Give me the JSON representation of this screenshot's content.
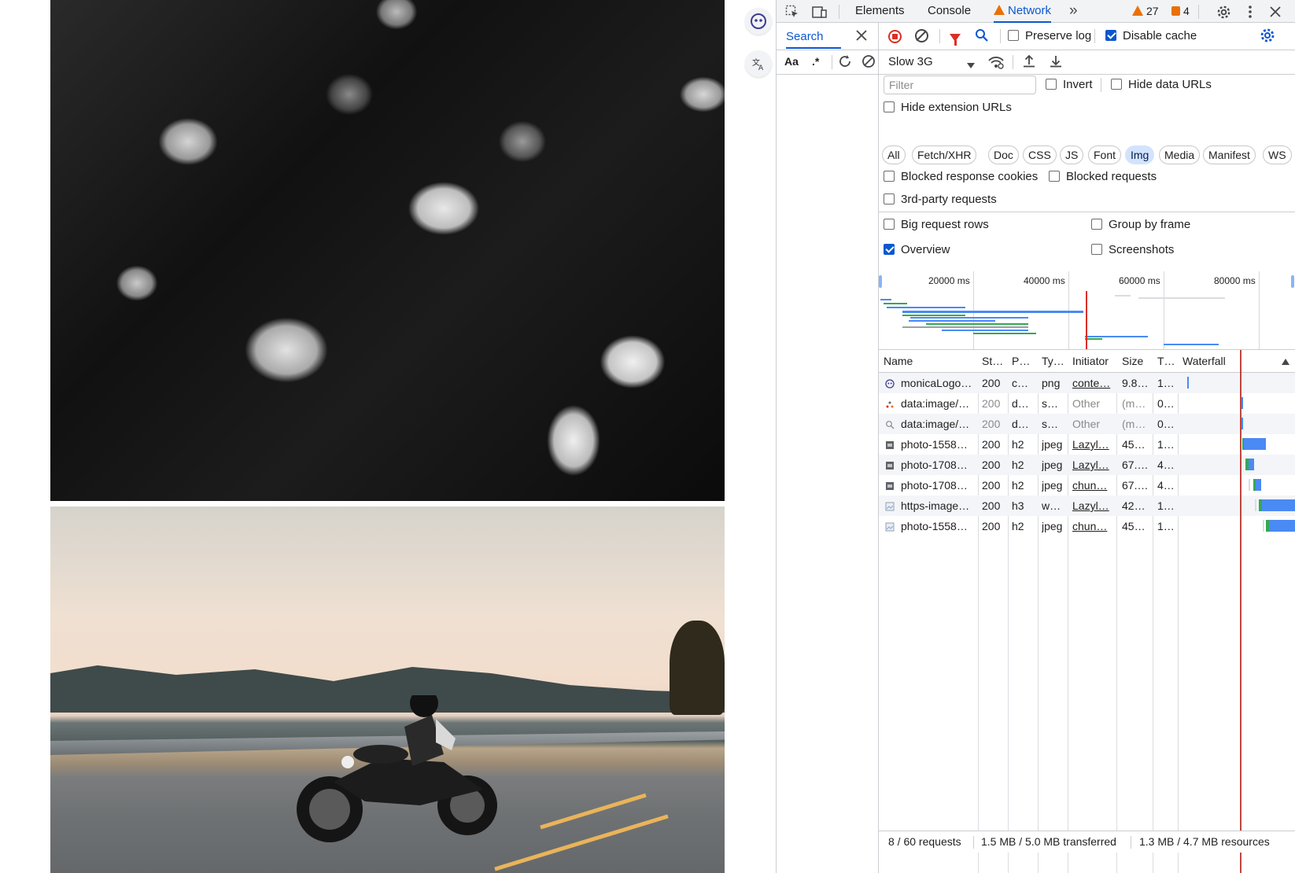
{
  "devtools": {
    "tabs": [
      {
        "label": "Elements",
        "active": false
      },
      {
        "label": "Console",
        "active": false
      },
      {
        "label": "Network",
        "active": true,
        "warning": true
      }
    ],
    "more_tabs_label": "»",
    "warnings_count": "27",
    "issues_count": "4"
  },
  "search_drawer": {
    "tab_label": "Search",
    "match_case_label": "Aa",
    "regex_label": ".*"
  },
  "network_toolbar": {
    "preserve_log_label": "Preserve log",
    "preserve_log_checked": false,
    "disable_cache_label": "Disable cache",
    "disable_cache_checked": true,
    "throttling_value": "Slow 3G"
  },
  "filters": {
    "filter_placeholder": "Filter",
    "invert_label": "Invert",
    "hide_data_urls_label": "Hide data URLs",
    "hide_extension_urls_label": "Hide extension URLs",
    "type_chips": [
      {
        "label": "All",
        "active": false
      },
      {
        "label": "Fetch/XHR",
        "active": false
      },
      {
        "label": "Doc",
        "active": false
      },
      {
        "label": "CSS",
        "active": false
      },
      {
        "label": "JS",
        "active": false
      },
      {
        "label": "Font",
        "active": false
      },
      {
        "label": "Img",
        "active": true
      },
      {
        "label": "Media",
        "active": false
      },
      {
        "label": "Manifest",
        "active": false
      },
      {
        "label": "WS",
        "active": false
      }
    ],
    "blocked_response_cookies_label": "Blocked response cookies",
    "blocked_requests_label": "Blocked requests",
    "third_party_label": "3rd-party requests"
  },
  "settings": {
    "big_request_rows_label": "Big request rows",
    "group_by_frame_label": "Group by frame",
    "overview_label": "Overview",
    "overview_checked": true,
    "screenshots_label": "Screenshots"
  },
  "overview": {
    "tick_labels": [
      "20000 ms",
      "40000 ms",
      "60000 ms",
      "80000 ms"
    ]
  },
  "table": {
    "columns": [
      "Name",
      "St…",
      "P…",
      "Ty…",
      "Initiator",
      "Size",
      "T…",
      "Waterfall"
    ],
    "rows": [
      {
        "name": "monicaLogo…",
        "status": "200",
        "protocol": "c…",
        "type": "png",
        "initiator": "conte…",
        "size": "9.8…",
        "time": "1…",
        "icon": "monica-logo-icon",
        "dim": false
      },
      {
        "name": "data:image/…",
        "status": "200",
        "protocol": "d…",
        "type": "s…",
        "initiator": "Other",
        "size": "(m…",
        "time": "0…",
        "icon": "svg-dots-icon",
        "dim": true
      },
      {
        "name": "data:image/…",
        "status": "200",
        "protocol": "d…",
        "type": "s…",
        "initiator": "Other",
        "size": "(m…",
        "time": "0…",
        "icon": "search-svg-icon",
        "dim": true
      },
      {
        "name": "photo-1558…",
        "status": "200",
        "protocol": "h2",
        "type": "jpeg",
        "initiator": "Lazyl…",
        "size": "45…",
        "time": "1…",
        "icon": "image-thumbnail-icon",
        "dim": false
      },
      {
        "name": "photo-1708…",
        "status": "200",
        "protocol": "h2",
        "type": "jpeg",
        "initiator": "Lazyl…",
        "size": "67.…",
        "time": "4…",
        "icon": "image-thumbnail-icon",
        "dim": false
      },
      {
        "name": "photo-1708…",
        "status": "200",
        "protocol": "h2",
        "type": "jpeg",
        "initiator": "chun…",
        "size": "67.…",
        "time": "4…",
        "icon": "image-thumbnail-icon",
        "dim": false
      },
      {
        "name": "https-image…",
        "status": "200",
        "protocol": "h3",
        "type": "w…",
        "initiator": "Lazyl…",
        "size": "42…",
        "time": "1…",
        "icon": "image-file-icon",
        "dim": false
      },
      {
        "name": "photo-1558…",
        "status": "200",
        "protocol": "h2",
        "type": "jpeg",
        "initiator": "chun…",
        "size": "45…",
        "time": "1…",
        "icon": "image-file-icon",
        "dim": false
      }
    ]
  },
  "status_bar": {
    "requests": "8 / 60 requests",
    "transferred": "1.5 MB / 5.0 MB transferred",
    "resources": "1.3 MB / 4.7 MB resources"
  },
  "colors": {
    "accent": "#0b57d0",
    "warning": "#e8710a",
    "record": "#d93025",
    "waterfall_blue": "#4a8af4",
    "waterfall_green": "#34a853"
  }
}
